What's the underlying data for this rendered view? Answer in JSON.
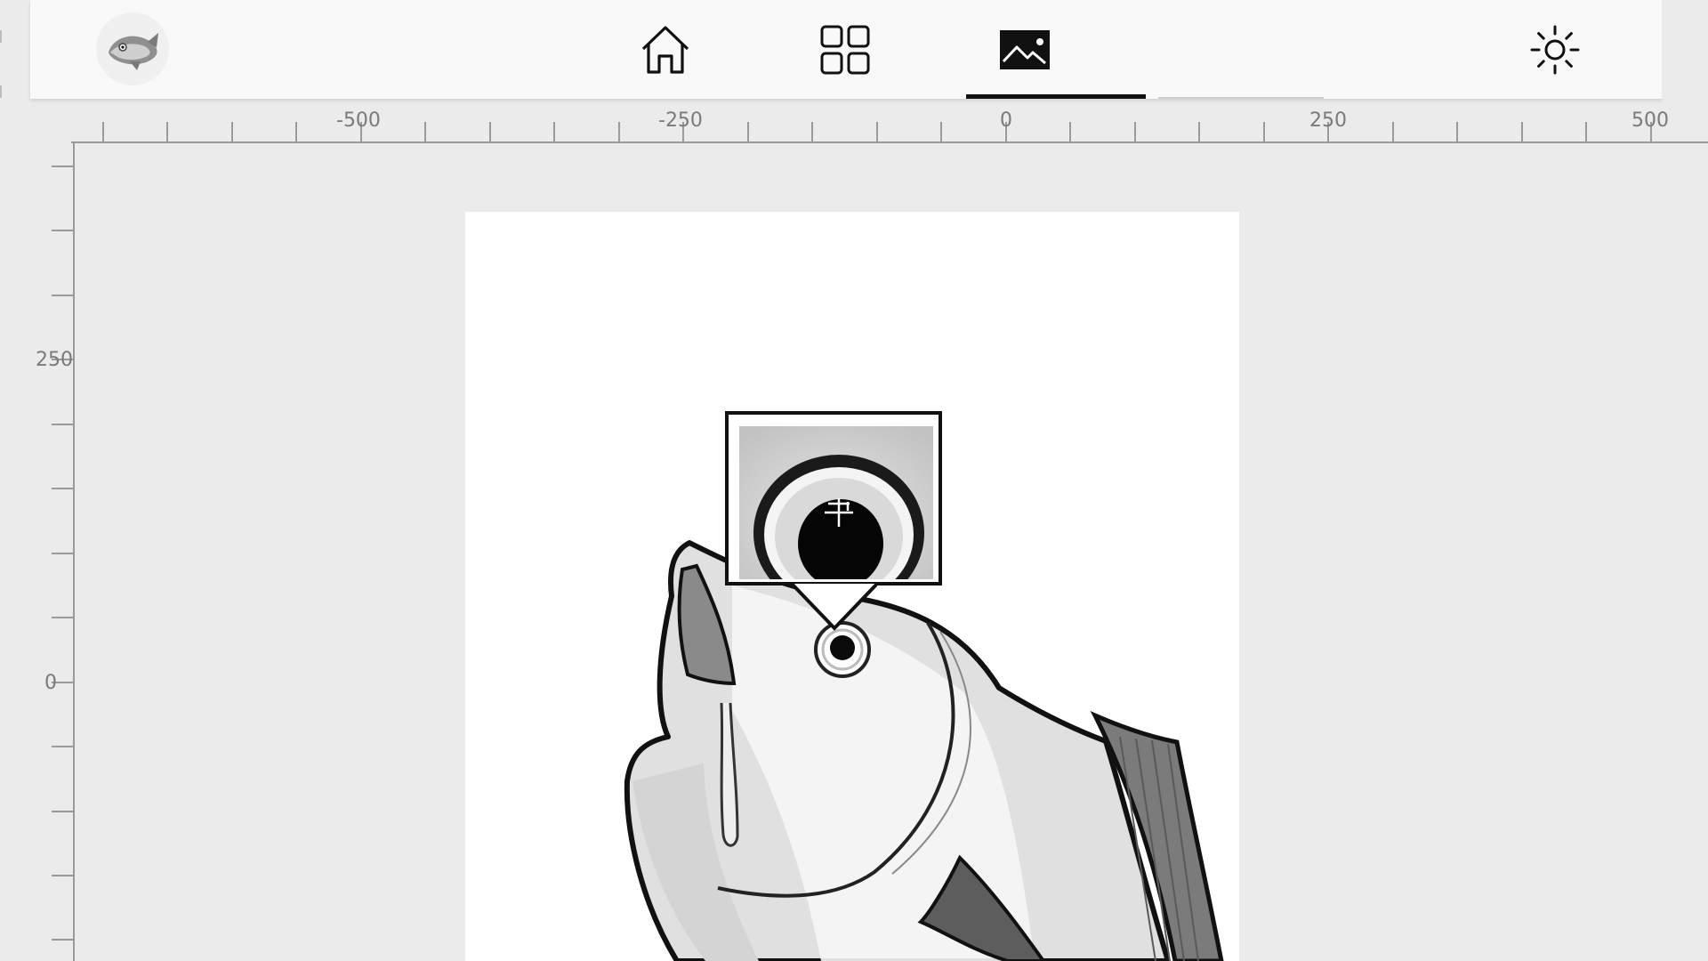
{
  "app": {
    "logo_icon": "fish-logo-icon",
    "accent": "#111111"
  },
  "toolbar": {
    "buttons": [
      {
        "id": "home",
        "icon": "home-icon",
        "active": false
      },
      {
        "id": "grid",
        "icon": "grid-icon",
        "active": false
      },
      {
        "id": "image",
        "icon": "image-icon",
        "active": true
      },
      {
        "id": "settings",
        "icon": "brightness-icon",
        "active": false
      }
    ]
  },
  "ruler": {
    "horizontal_labels": [
      "-500",
      "-250",
      "0",
      "250",
      "500"
    ],
    "vertical_labels": [
      "250",
      "0"
    ]
  },
  "canvas": {
    "background": "#ffffff",
    "image_subject": "fish-illustration",
    "magnifier": {
      "visible": true,
      "crosshair_icon": "crosshair-icon"
    }
  }
}
